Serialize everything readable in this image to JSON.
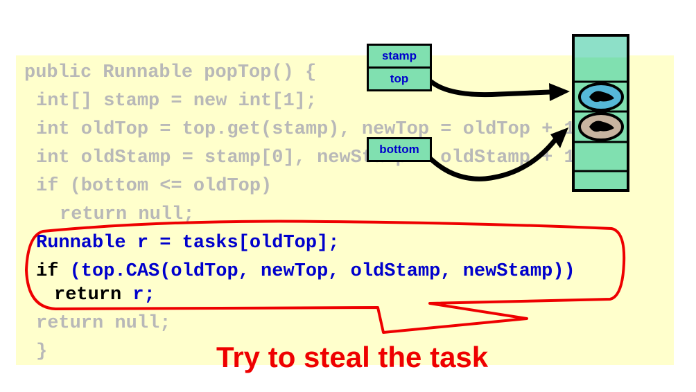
{
  "code": {
    "line1": "public Runnable popTop() {",
    "line2": "int[] stamp = new int[1];",
    "line3": "int oldTop = top.get(stamp), newTop = oldTop + 1;",
    "line4": "int oldStamp = stamp[0], newStamp = oldStamp + 1;",
    "line5": "if (bottom <= oldTop)",
    "line6": "return null;",
    "line7": "Runnable r = tasks[oldTop];",
    "line8_kw": "if",
    "line8_rest": " (top.CAS(oldTop, newTop, oldStamp, newStamp))",
    "line9_kw": "return",
    "line9_rest": " r;",
    "line10": "return null;",
    "line11": "}"
  },
  "diagram": {
    "stamp_label": "stamp",
    "top_label": "top",
    "bottom_label": "bottom"
  },
  "caption": "Try to steal the task",
  "colors": {
    "panel_bg": "#ffffcc",
    "box_fill": "#80e0b0",
    "highlight": "#ee0000",
    "code_blue": "#0000cc",
    "dim_text": "#b8b8b8",
    "slot_blue": "#56b8d8",
    "slot_tan": "#c8b4a0"
  }
}
